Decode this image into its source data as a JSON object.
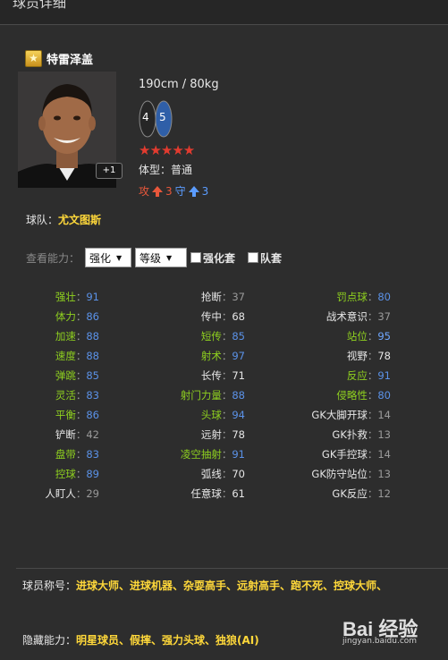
{
  "header": {
    "title": "球员详细"
  },
  "player": {
    "name": "特雷泽盖",
    "height_weight": "190cm / 80kg",
    "foot_left": "4",
    "foot_right": "5",
    "stars": "★★★★★",
    "plus_badge": "+1",
    "body_type_label": "体型：",
    "body_type": "普通",
    "attack_label": "攻",
    "attack_value": "3",
    "defense_label": "守",
    "defense_value": "3",
    "team_label": "球队：",
    "team": "尤文图斯"
  },
  "filter": {
    "label": "查看能力：",
    "select1": "强化",
    "select2": "等级",
    "check1": "强化套",
    "check2": "队套"
  },
  "attributes": [
    [
      {
        "k": "强壮",
        "v": "91",
        "kc": "green",
        "vc": "blue"
      },
      {
        "k": "抢断",
        "v": "37",
        "kc": "white",
        "vc": "grey"
      },
      {
        "k": "罚点球",
        "v": "80",
        "kc": "green",
        "vc": "blue"
      }
    ],
    [
      {
        "k": "体力",
        "v": "86",
        "kc": "green",
        "vc": "blue"
      },
      {
        "k": "传中",
        "v": "68",
        "kc": "white",
        "vc": "white"
      },
      {
        "k": "战术意识",
        "v": "37",
        "kc": "white",
        "vc": "grey"
      }
    ],
    [
      {
        "k": "加速",
        "v": "88",
        "kc": "green",
        "vc": "blue"
      },
      {
        "k": "短传",
        "v": "85",
        "kc": "green",
        "vc": "blue"
      },
      {
        "k": "站位",
        "v": "95",
        "kc": "green",
        "vc": "lblue"
      }
    ],
    [
      {
        "k": "速度",
        "v": "88",
        "kc": "green",
        "vc": "blue"
      },
      {
        "k": "射术",
        "v": "97",
        "kc": "green",
        "vc": "blue"
      },
      {
        "k": "视野",
        "v": "78",
        "kc": "white",
        "vc": "white"
      }
    ],
    [
      {
        "k": "弹跳",
        "v": "85",
        "kc": "green",
        "vc": "blue"
      },
      {
        "k": "长传",
        "v": "71",
        "kc": "white",
        "vc": "white"
      },
      {
        "k": "反应",
        "v": "91",
        "kc": "green",
        "vc": "blue"
      }
    ],
    [
      {
        "k": "灵活",
        "v": "83",
        "kc": "green",
        "vc": "blue"
      },
      {
        "k": "射门力量",
        "v": "88",
        "kc": "green",
        "vc": "blue"
      },
      {
        "k": "侵略性",
        "v": "80",
        "kc": "green",
        "vc": "blue"
      }
    ],
    [
      {
        "k": "平衡",
        "v": "86",
        "kc": "green",
        "vc": "blue"
      },
      {
        "k": "头球",
        "v": "94",
        "kc": "green",
        "vc": "blue"
      },
      {
        "k": "GK大脚开球",
        "v": "14",
        "kc": "white",
        "vc": "grey"
      }
    ],
    [
      {
        "k": "铲断",
        "v": "42",
        "kc": "white",
        "vc": "grey"
      },
      {
        "k": "远射",
        "v": "78",
        "kc": "white",
        "vc": "white"
      },
      {
        "k": "GK扑救",
        "v": "13",
        "kc": "white",
        "vc": "grey"
      }
    ],
    [
      {
        "k": "盘带",
        "v": "83",
        "kc": "green",
        "vc": "blue"
      },
      {
        "k": "凌空抽射",
        "v": "91",
        "kc": "green",
        "vc": "blue"
      },
      {
        "k": "GK手控球",
        "v": "14",
        "kc": "white",
        "vc": "grey"
      }
    ],
    [
      {
        "k": "控球",
        "v": "89",
        "kc": "green",
        "vc": "blue"
      },
      {
        "k": "弧线",
        "v": "70",
        "kc": "white",
        "vc": "white"
      },
      {
        "k": "GK防守站位",
        "v": "13",
        "kc": "white",
        "vc": "grey"
      }
    ],
    [
      {
        "k": "人盯人",
        "v": "29",
        "kc": "white",
        "vc": "grey"
      },
      {
        "k": "任意球",
        "v": "61",
        "kc": "white",
        "vc": "white"
      },
      {
        "k": "GK反应",
        "v": "12",
        "kc": "white",
        "vc": "grey"
      }
    ]
  ],
  "titles": {
    "label": "球员称号：",
    "value": "进球大师、进球机器、杂耍高手、远射高手、跑不死、控球大师、"
  },
  "hidden": {
    "label": "隐藏能力：",
    "value": "明星球员、假摔、强力头球、独狼(AI)"
  },
  "watermark": {
    "brand": "Bai 经验",
    "url": "jingyan.baidu.com"
  },
  "colors": {
    "accent_yellow": "#ffd83a",
    "green": "#8fd11f",
    "blue": "#5b92e8",
    "star_red": "#e23b2f"
  }
}
